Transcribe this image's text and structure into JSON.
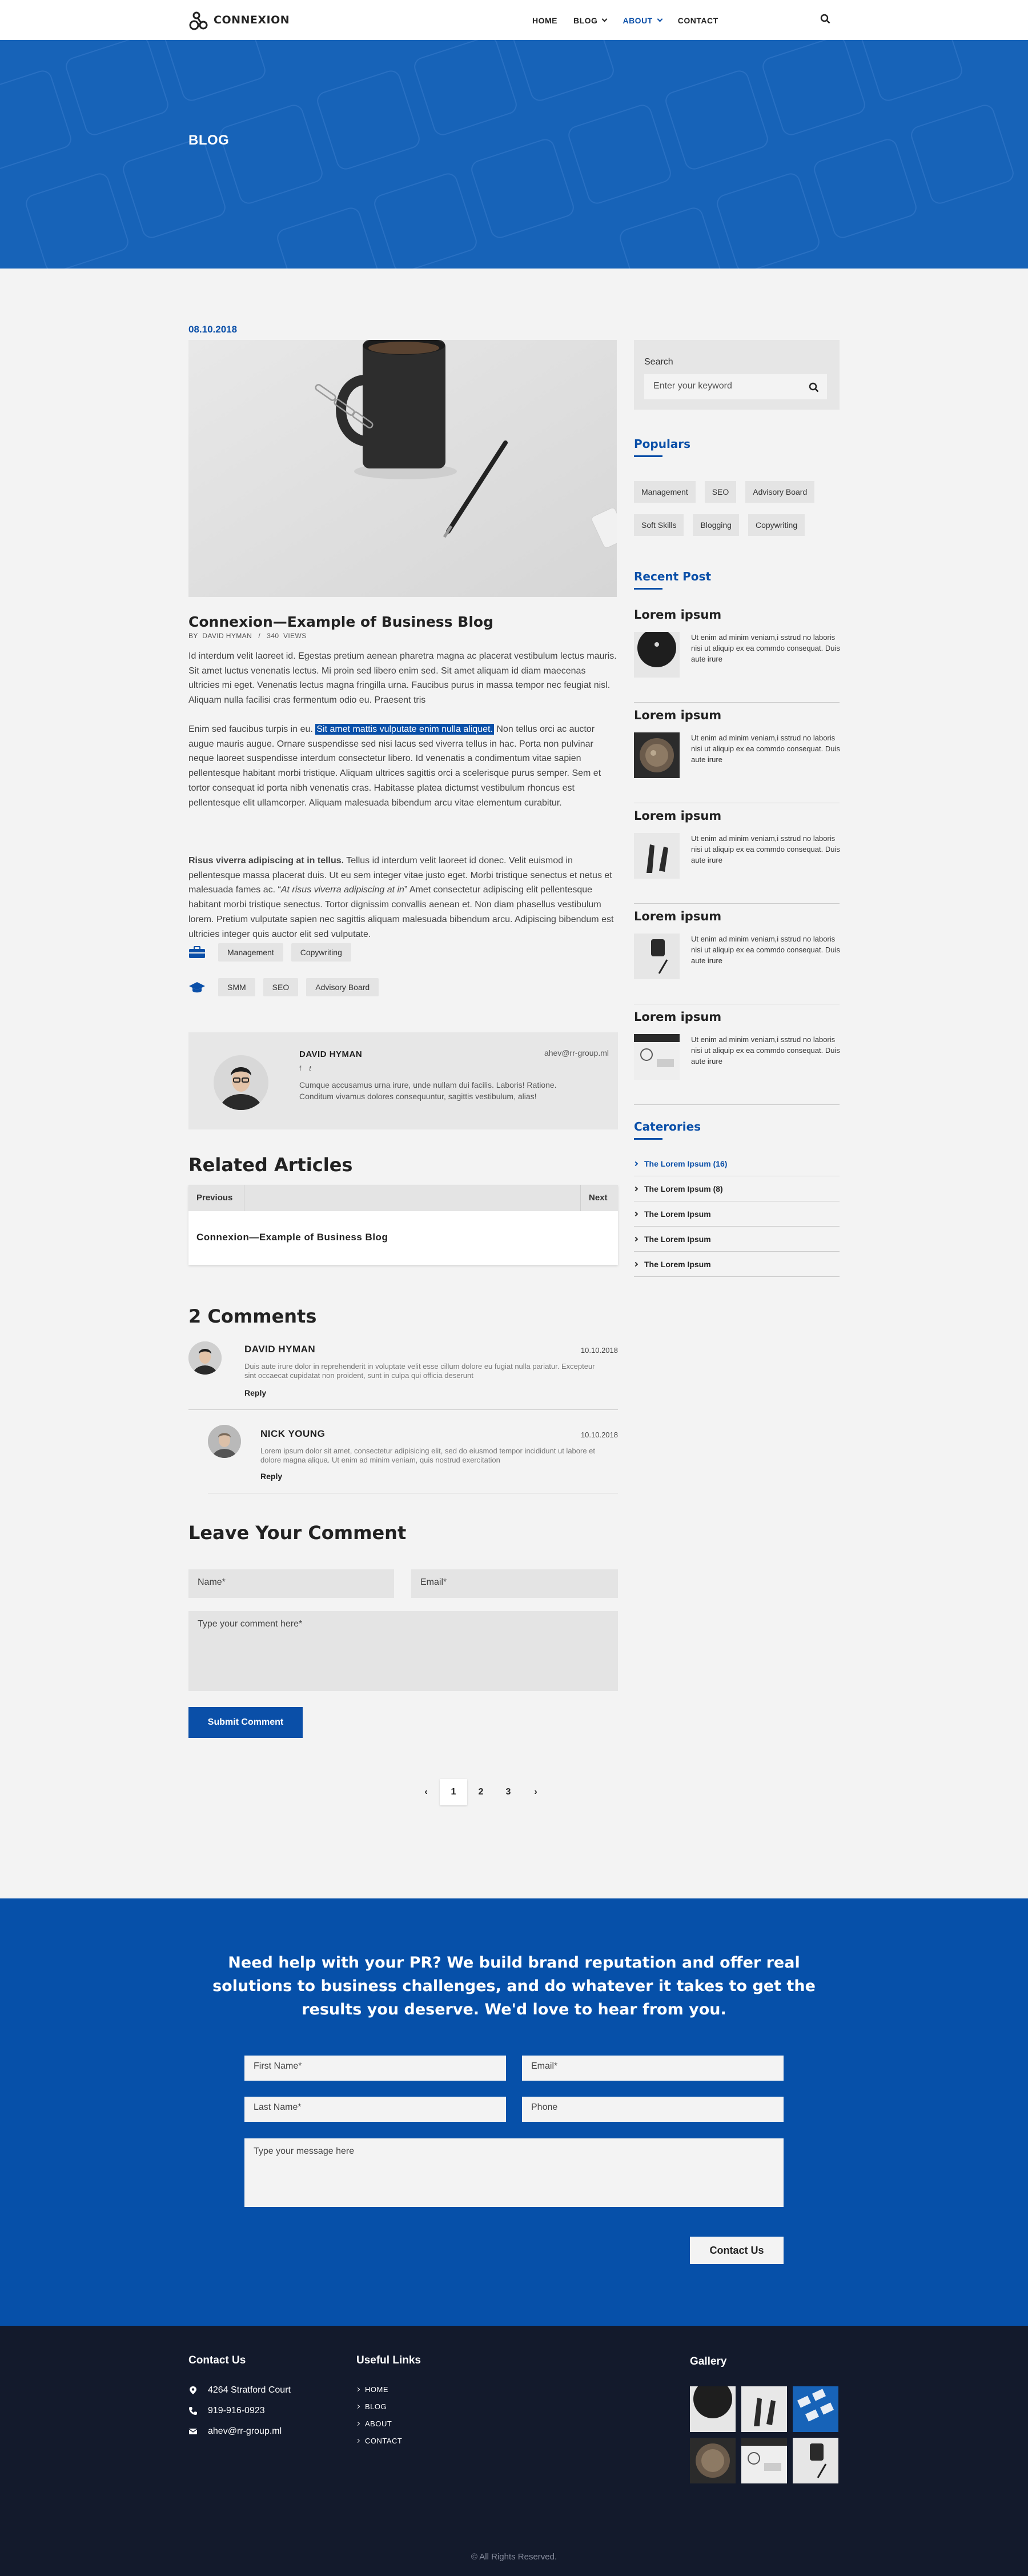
{
  "brand": {
    "name": "CONNEXION"
  },
  "nav": {
    "items": [
      {
        "label": "HOME",
        "dropdown": false,
        "active": false
      },
      {
        "label": "BLOG",
        "dropdown": true,
        "active": false
      },
      {
        "label": "ABOUT",
        "dropdown": true,
        "active": true
      },
      {
        "label": "CONTACT",
        "dropdown": false,
        "active": false
      }
    ]
  },
  "hero": {
    "title": "BLOG"
  },
  "post": {
    "date": "08.10.2018",
    "title": "Connexion—Example of Business Blog",
    "meta_by": "BY",
    "meta_author": "DAVID HYMAN",
    "meta_sep": "/",
    "meta_views_count": "340",
    "meta_views_label": "VIEWS",
    "p1": "Id interdum velit laoreet id. Egestas pretium aenean pharetra magna ac placerat vestibulum lectus mauris. Sit amet luctus venenatis lectus. Mi proin sed libero enim sed. Sit amet aliquam id diam maecenas ultricies mi eget. Venenatis lectus magna fringilla urna. Faucibus purus in massa tempor nec feugiat nisl. Aliquam nulla facilisi cras fermentum odio eu. Praesent tris",
    "p2_before": "Enim sed faucibus turpis in eu. ",
    "p2_highlight": "Sit amet mattis vulputate enim nulla aliquet.",
    "p2_after": " Non tellus orci ac auctor augue mauris augue. Ornare suspendisse sed nisi lacus sed viverra tellus in hac. Porta non pulvinar neque laoreet suspendisse interdum consectetur libero. Id venenatis a condimentum vitae sapien pellentesque habitant morbi tristique. Aliquam ultrices sagittis orci a scelerisque purus semper. Sem et tortor consequat id porta nibh venenatis cras. Habitasse platea dictumst vestibulum rhoncus est pellentesque elit ullamcorper. Aliquam malesuada bibendum arcu vitae elementum curabitur.",
    "p3_bold": "Risus viverra adipiscing at in tellus.",
    "p3_a": " Tellus id interdum velit laoreet id donec. Velit euismod in pellentesque massa placerat duis. Ut eu sem integer vitae justo eget. Morbi tristique senectus et netus et malesuada fames ac. “",
    "p3_italic": "At risus viverra adipiscing at in",
    "p3_b": "” Amet consectetur adipiscing elit pellentesque habitant morbi tristique senectus. Tortor dignissim convallis aenean et. Non diam phasellus vestibulum lorem. Pretium vulputate sapien nec sagittis aliquam malesuada bibendum arcu. Adipiscing bibendum est ultricies integer quis auctor elit sed vulputate.",
    "category_tags": [
      "Management",
      "Copywriting"
    ],
    "skill_tags": [
      "SMM",
      "SEO",
      "Advisory Board"
    ]
  },
  "author": {
    "name": "DAVID HYMAN",
    "email": "ahev@rr-group.ml",
    "social": [
      "f",
      "𝑡"
    ],
    "bio": "Cumque accusamus urna irure, unde nullam dui facilis. Laboris! Ratione. Conditum vivamus dolores consequuntur, sagittis vestibulum, alias!"
  },
  "related": {
    "heading": "Related Articles",
    "prev": "Previous",
    "next": "Next",
    "article_title": "Connexion—Example of Business Blog"
  },
  "comments": {
    "heading": "2 Comments",
    "items": [
      {
        "name": "DAVID HYMAN",
        "date": "10.10.2018",
        "text": "Duis aute irure dolor in reprehenderit in voluptate velit esse cillum dolore eu fugiat nulla pariatur. Excepteur sint occaecat cupidatat non proident, sunt in culpa qui officia deserunt",
        "reply": "Reply"
      },
      {
        "name": "NICK YOUNG",
        "date": "10.10.2018",
        "text": "Lorem ipsum dolor sit amet, consectetur adipisicing elit, sed do eiusmod tempor incididunt ut labore et dolore magna aliqua. Ut enim ad minim veniam, quis nostrud exercitation",
        "reply": "Reply"
      }
    ]
  },
  "leave_comment": {
    "heading": "Leave Your Comment",
    "name_placeholder": "Name*",
    "email_placeholder": "Email*",
    "comment_placeholder": "Type your comment here*",
    "submit_label": "Submit Comment"
  },
  "pagination": {
    "prev": "‹",
    "pages": [
      "1",
      "2",
      "3"
    ],
    "current": "1",
    "next": "›"
  },
  "sidebar": {
    "search_label": "Search",
    "search_placeholder": "Enter your keyword",
    "populars_heading": "Populars",
    "popular_tags": [
      "Management",
      "SEO",
      "Advisory Board",
      "Soft Skills",
      "Blogging",
      "Copywriting"
    ],
    "recent_heading": "Recent Post",
    "recent_posts": [
      {
        "title": "Lorem ipsum",
        "text": "Ut enim ad minim veniam,i sstrud  no laboris nisi ut aliquip ex ea commdo consequat. Duis aute irure"
      },
      {
        "title": "Lorem ipsum",
        "text": "Ut enim ad minim veniam,i sstrud  no laboris nisi ut aliquip ex ea commdo consequat. Duis aute irure"
      },
      {
        "title": "Lorem ipsum",
        "text": "Ut enim ad minim veniam,i sstrud  no laboris nisi ut aliquip ex ea commdo consequat. Duis aute irure"
      },
      {
        "title": "Lorem ipsum",
        "text": "Ut enim ad minim veniam,i sstrud  no laboris nisi ut aliquip ex ea commdo consequat. Duis aute irure"
      },
      {
        "title": "Lorem ipsum",
        "text": "Ut enim ad minim veniam,i sstrud  no laboris nisi ut aliquip ex ea commdo consequat. Duis aute irure"
      }
    ],
    "categories_heading": "Caterories",
    "categories": [
      {
        "label": "The Lorem Ipsum (16)",
        "active": true
      },
      {
        "label": "The Lorem Ipsum (8)",
        "active": false
      },
      {
        "label": "The Lorem Ipsum",
        "active": false
      },
      {
        "label": "The Lorem Ipsum",
        "active": false
      },
      {
        "label": "The Lorem Ipsum",
        "active": false
      }
    ]
  },
  "cta": {
    "text": "Need help with your PR? We build brand reputation and offer real solutions to business challenges, and do whatever it takes to get the results you deserve. We'd love to hear from you.",
    "first_name": "First Name*",
    "email": "Email*",
    "last_name": "Last Name*",
    "phone": "Phone",
    "message": "Type your message here",
    "button": "Contact Us"
  },
  "footer": {
    "contact_heading": "Contact Us",
    "address": "4264 Stratford Court",
    "phone": "919-916-0923",
    "email": "ahev@rr-group.ml",
    "links_heading": "Useful Links",
    "links": [
      "HOME",
      "BLOG",
      "ABOUT",
      "CONTACT"
    ],
    "gallery_heading": "Gallery",
    "copyright": "© All Rights Reserved."
  },
  "colors": {
    "accent": "#0a4fa8",
    "hero": "#1763b8",
    "cta": "#0650a9",
    "footer": "#131a2c",
    "page": "#f3f3f3"
  }
}
